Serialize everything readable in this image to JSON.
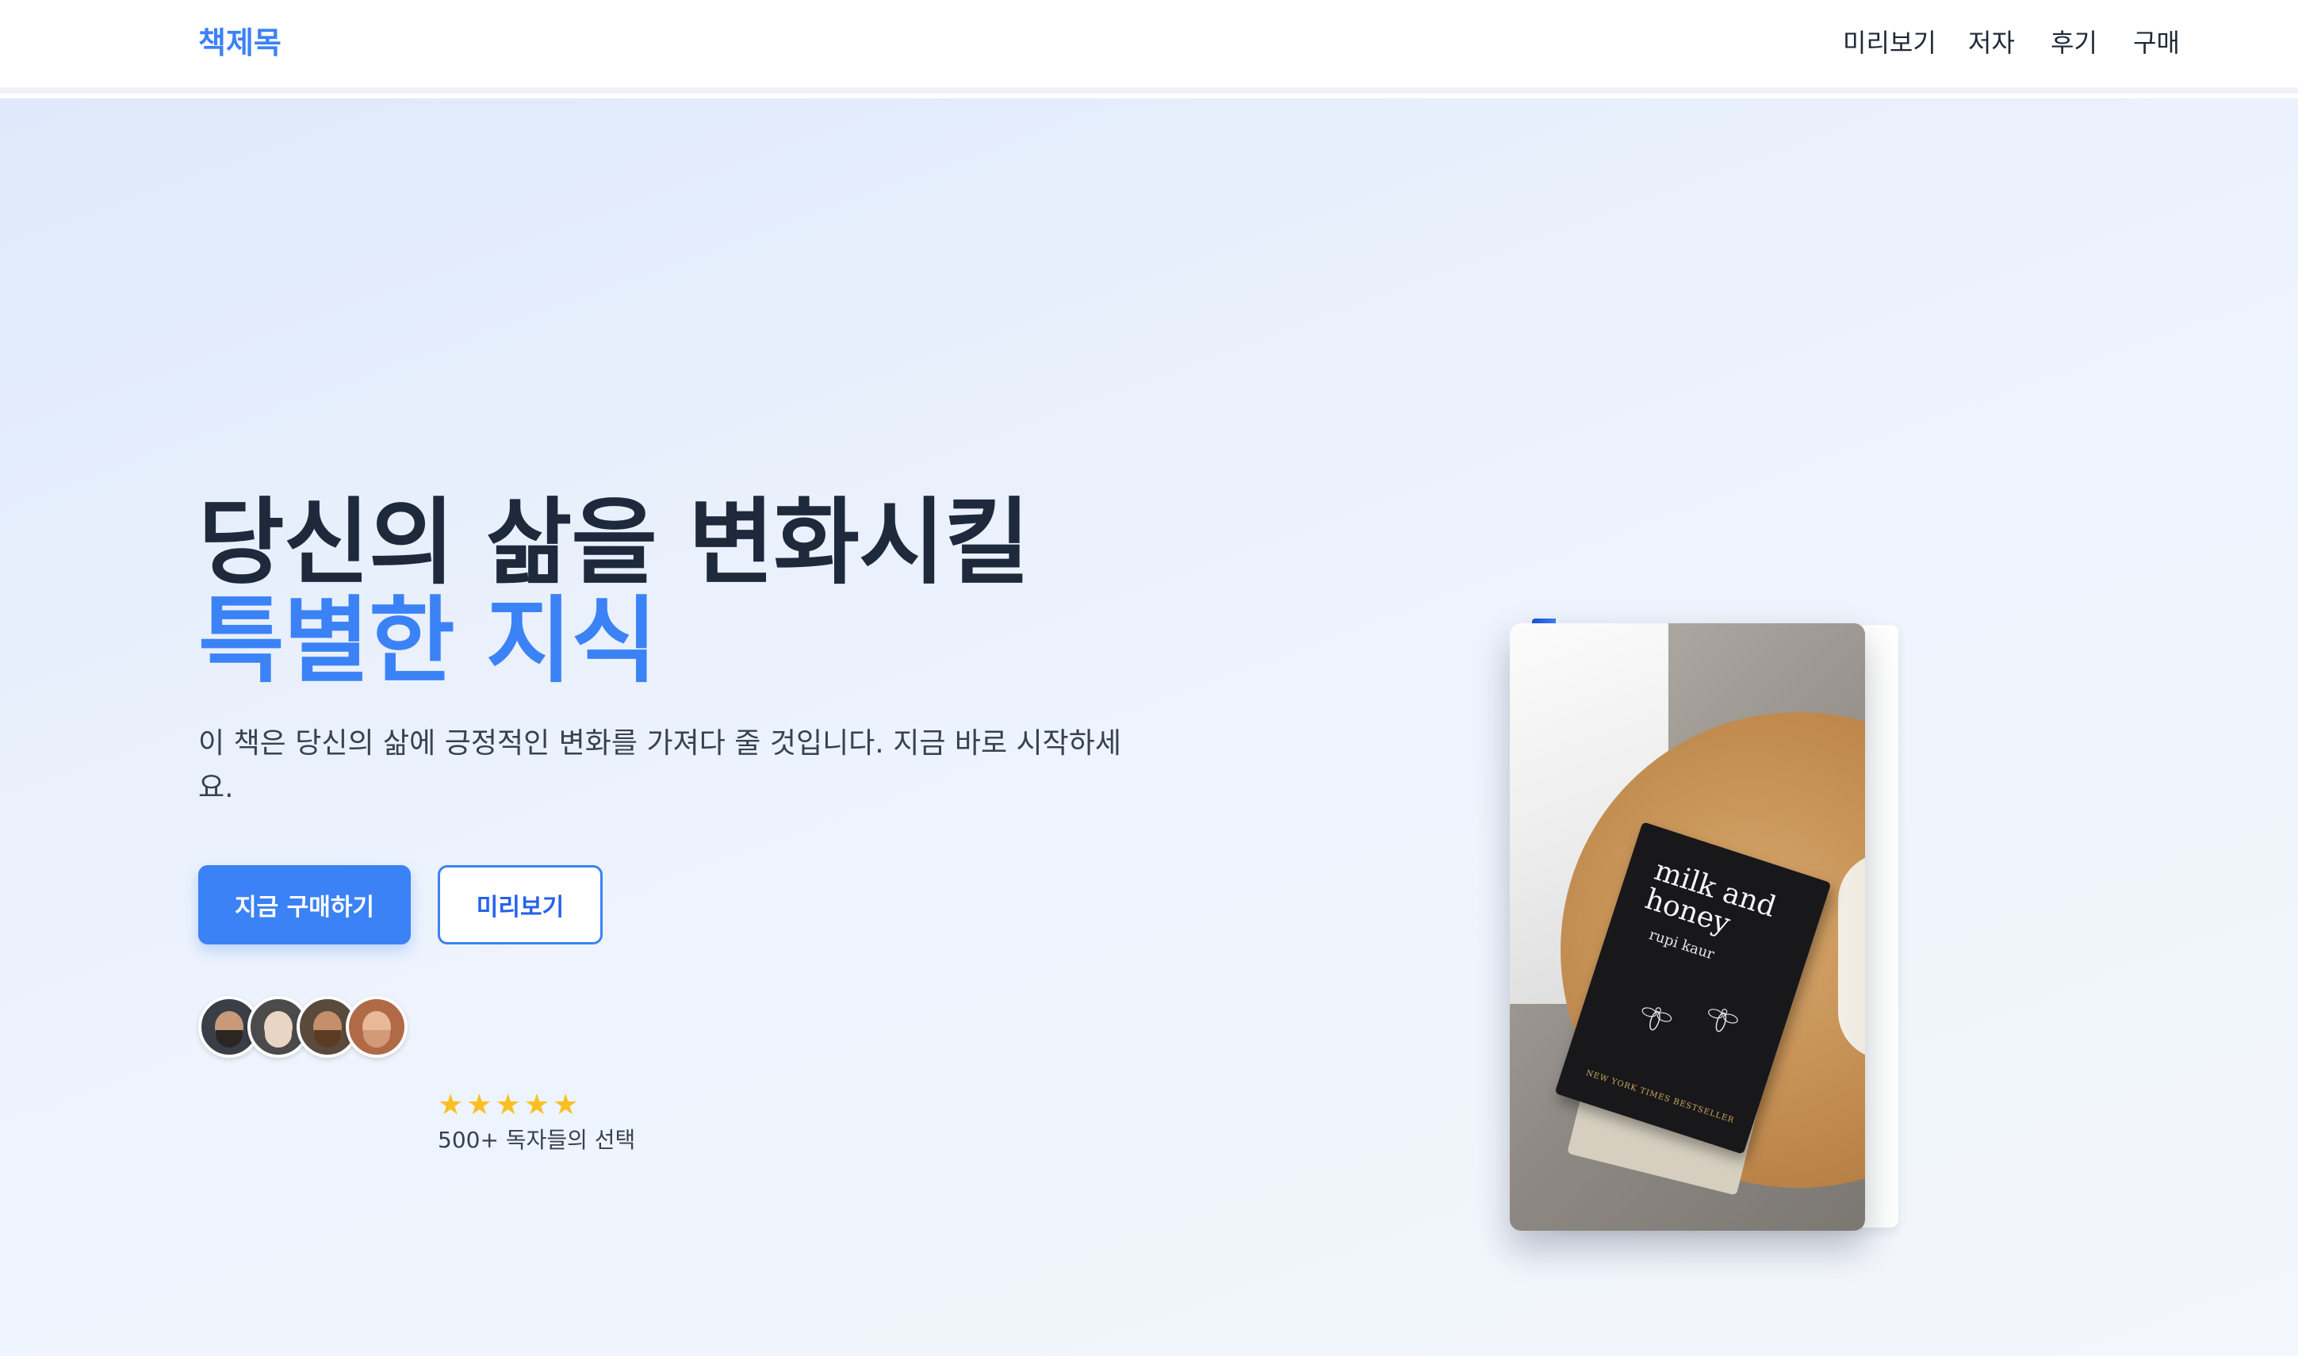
{
  "navbar": {
    "brand": "책제목",
    "links": [
      {
        "label": "미리보기"
      },
      {
        "label": "저자"
      },
      {
        "label": "후기"
      },
      {
        "label": "구매"
      }
    ]
  },
  "hero": {
    "headline_line1": "당신의 삶을 변화시킬",
    "headline_line2": "특별한 지식",
    "subtext": "이 책은 당신의 삶에 긍정적인 변화를 가져다 줄 것입니다. 지금 바로 시작하세요.",
    "buttons": {
      "primary": "지금 구매하기",
      "secondary": "미리보기"
    },
    "social_proof": {
      "stars": "★★★★★",
      "rating": 5,
      "readers": "500+ 독자들의 선택"
    }
  },
  "book": {
    "cover_title": "milk and honey",
    "cover_author": "rupi kaur",
    "cover_tag": "NEW YORK TIMES BESTSELLER"
  },
  "colors": {
    "accent": "#3b82f6",
    "heading": "#1e293b",
    "star": "#fbbf24"
  }
}
